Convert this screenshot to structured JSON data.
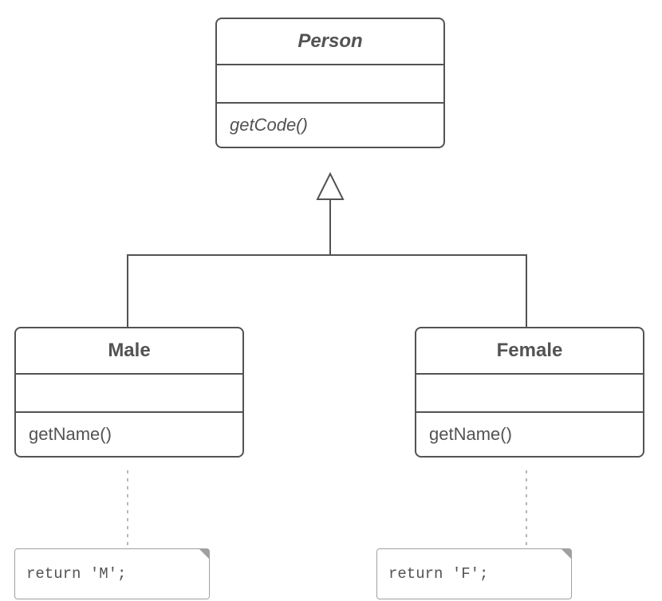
{
  "classes": {
    "person": {
      "name": "Person",
      "methods": [
        "getCode()"
      ]
    },
    "male": {
      "name": "Male",
      "methods": [
        "getName()"
      ]
    },
    "female": {
      "name": "Female",
      "methods": [
        "getName()"
      ]
    }
  },
  "notes": {
    "male": "return 'M';",
    "female": "return 'F';"
  }
}
